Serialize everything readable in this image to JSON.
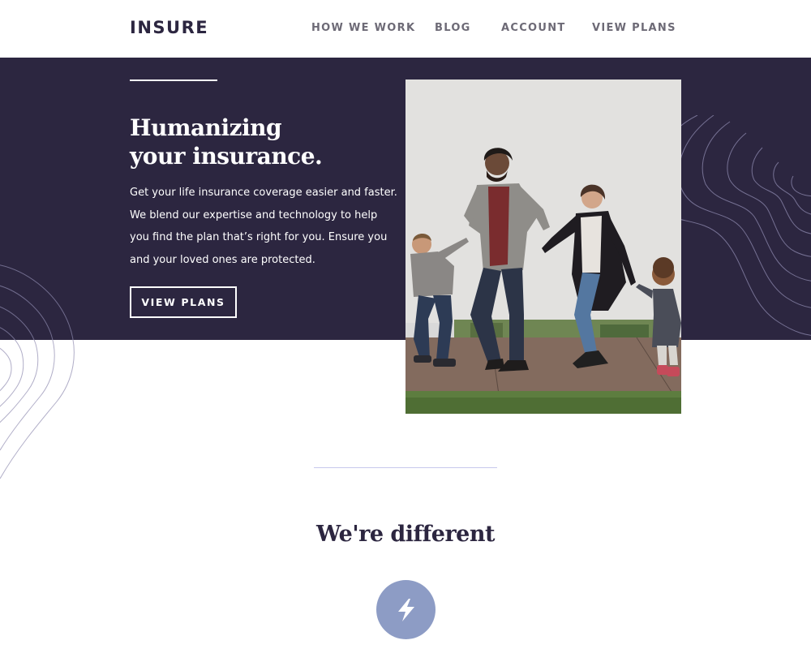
{
  "brand": {
    "logo": "INSURE"
  },
  "nav": {
    "items": [
      {
        "label": "HOW WE WORK"
      },
      {
        "label": "BLOG"
      },
      {
        "label": "ACCOUNT"
      },
      {
        "label": "VIEW PLANS"
      }
    ]
  },
  "hero": {
    "title_line1": "Humanizing",
    "title_line2": "your insurance.",
    "text": "Get your life insurance coverage easier and faster. We blend our expertise and technology to help you find the plan that’s right for you. Ensure you and your loved ones are protected.",
    "button_label": "VIEW PLANS"
  },
  "section": {
    "title": "We're different"
  },
  "icons": {
    "feature": "lightning-bolt-icon",
    "decor": "topographic-lines"
  },
  "colors": {
    "dark_violet": "#2c2640",
    "nav_text": "#6d6a76",
    "icon_circle": "#8d9cc5",
    "rule_light": "#c7c8ec",
    "white": "#ffffff"
  }
}
